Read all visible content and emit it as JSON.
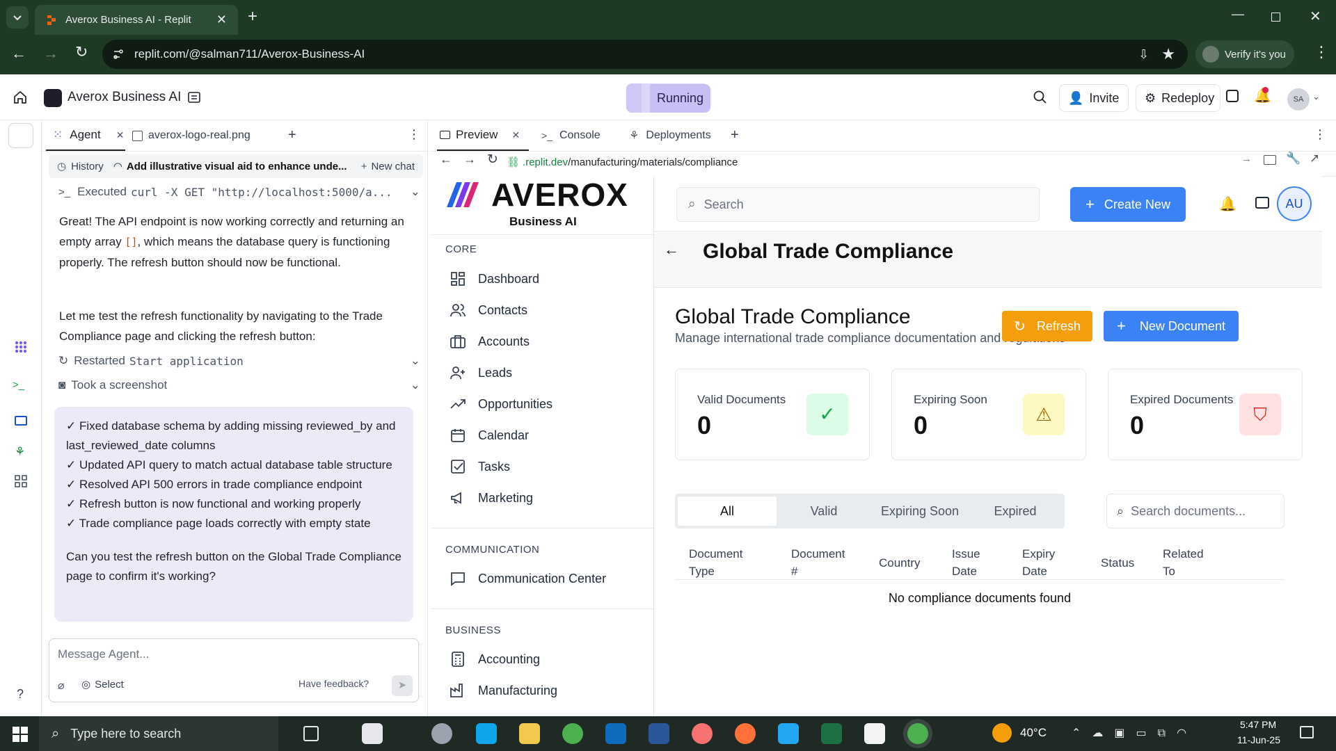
{
  "browser": {
    "tab_title": "Averox Business AI - Replit",
    "url": "replit.com/@salman711/Averox-Business-AI",
    "profile_button": "Verify it's you"
  },
  "replit_header": {
    "project_name": "Averox Business AI",
    "run_status": "Running",
    "invite": "Invite",
    "redeploy": "Redeploy",
    "avatar": "SA"
  },
  "agent_panel": {
    "tabs": [
      "Agent",
      "averox-logo-real.png"
    ],
    "history": "History",
    "task_title": "Add illustrative visual aid to enhance unde...",
    "new_chat": "New chat",
    "executed_prefix": "Executed",
    "executed_cmd": "curl -X GET \"http://localhost:5000/a...",
    "para1_a": "Great! The API endpoint is now working correctly and returning an empty array ",
    "para1_code": "[]",
    "para1_b": ", which means the database query is functioning properly. The refresh button should now be functional.",
    "para2": "Let me test the refresh functionality by navigating to the Trade Compliance page and clicking the refresh button:",
    "tool1_label": "Restarted",
    "tool1_code": "Start application",
    "tool2_label": "Took a screenshot",
    "summary_items": [
      "✓ Fixed database schema by adding missing reviewed_by and last_reviewed_date columns",
      "✓ Updated API query to match actual database table structure",
      "✓ Resolved API 500 errors in trade compliance endpoint",
      "✓ Refresh button is now functional and working properly",
      "✓ Trade compliance page loads correctly with empty state"
    ],
    "summary_question": "Can you test the refresh button on the Global Trade Compliance page to confirm it's working?",
    "input_placeholder": "Message Agent...",
    "select_label": "Select",
    "feedback": "Have feedback?"
  },
  "preview_panel": {
    "tabs": [
      "Preview",
      "Console",
      "Deployments"
    ],
    "url_host": ".replit.dev",
    "url_path": "/manufacturing/materials/compliance"
  },
  "app": {
    "logo_text": "AVEROX",
    "logo_sub": "Business AI",
    "search_placeholder": "Search",
    "create_new": "Create New",
    "user_initials": "AU",
    "sections": {
      "core": "CORE",
      "communication": "COMMUNICATION",
      "business": "BUSINESS"
    },
    "core_items": [
      "Dashboard",
      "Contacts",
      "Accounts",
      "Leads",
      "Opportunities",
      "Calendar",
      "Tasks",
      "Marketing"
    ],
    "communication_items": [
      "Communication Center"
    ],
    "business_items": [
      "Accounting",
      "Manufacturing"
    ],
    "page_title": "Global Trade Compliance",
    "card_title": "Global Trade Compliance",
    "card_subtitle": "Manage international trade compliance documentation and regulations",
    "refresh": "Refresh",
    "new_document": "New Document",
    "stats": [
      {
        "label": "Valid Documents",
        "value": "0",
        "color": "#16a34a"
      },
      {
        "label": "Expiring Soon",
        "value": "0",
        "color": "#ca8a04"
      },
      {
        "label": "Expired Documents",
        "value": "0",
        "color": "#dc2626"
      }
    ],
    "filter_tabs": [
      "All",
      "Valid",
      "Expiring Soon",
      "Expired"
    ],
    "doc_search_placeholder": "Search documents...",
    "columns": [
      "Document\nType",
      "Document\n#",
      "Country",
      "Issue\nDate",
      "Expiry\nDate",
      "Status",
      "Related\nTo"
    ],
    "empty_message": "No compliance documents found"
  },
  "taskbar": {
    "search_placeholder": "Type here to search",
    "weather": "40°C",
    "time": "5:47 PM",
    "date": "11-Jun-25"
  },
  "colors": {
    "chrome_bg": "#1e3a24",
    "accent_blue": "#3b82f6",
    "refresh_orange": "#f59e0b",
    "running_bg": "#c7c0f5"
  }
}
